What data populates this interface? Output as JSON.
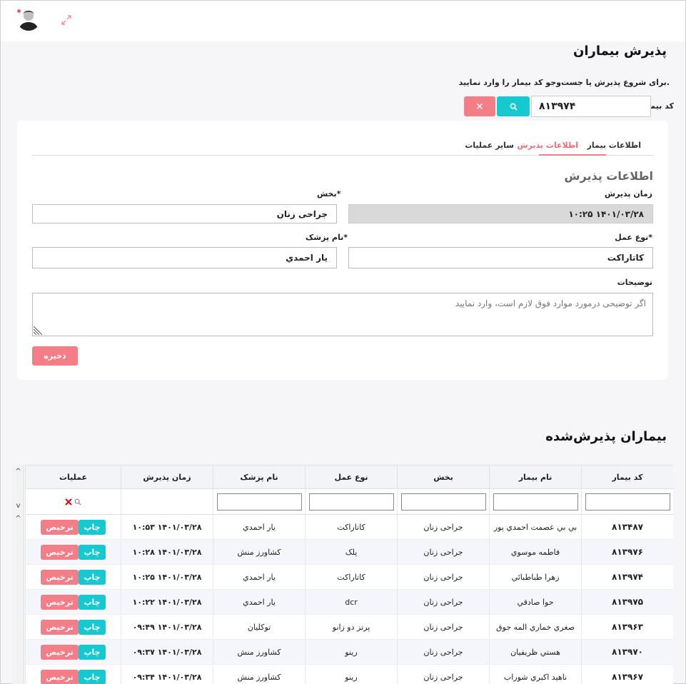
{
  "header": {
    "avatar": "user-avatar",
    "expand_icon": "expand-icon"
  },
  "page": {
    "title": "پذیرش بیماران",
    "hint": "برای شروع پذیرش یا جست‌وجو کد بیمار را وارد نمایید.",
    "code_label": "کد بیمار",
    "code_value": "۸۱۳۹۷۴",
    "clear_label": "×"
  },
  "tabs": [
    {
      "label": "اطلاعات بیمار"
    },
    {
      "label": "اطلاعات پذیرش"
    },
    {
      "label": "سایر عملیات"
    }
  ],
  "form": {
    "section_title": "اطلاعات پذیرش",
    "time_label": "زمان پذیرش",
    "time_value": "۱۴۰۱/۰۳/۲۸ ۱۰:۲۵",
    "dept_label": "بخش*",
    "dept_value": "جراحی زنان",
    "op_label": "نوع عمل*",
    "op_value": "کاتاراکت",
    "doctor_label": "نام پزشک*",
    "doctor_value": "یار احمدي",
    "notes_label": "توضیحات",
    "notes_placeholder": "اگر توضیحی درمورد موارد فوق لازم است، وارد نمایید",
    "save_label": "ذخیره"
  },
  "admitted": {
    "title": "بیماران پذیرش‌شده",
    "columns": [
      "کد بیمار",
      "نام بیمار",
      "بخش",
      "نوع عمل",
      "نام پزشک",
      "زمان پذیرش",
      "عملیات"
    ],
    "print_label": "چاپ",
    "discharge_label": "ترخیص",
    "rows": [
      {
        "code": "۸۱۳۴۸۷",
        "name": "بي بي عصمت احمدي پور",
        "dept": "جراحی زنان",
        "op": "کاتاراکت",
        "doctor": "یار احمدي",
        "time": "۱۴۰۱/۰۳/۲۸ ۱۰:۵۳"
      },
      {
        "code": "۸۱۳۹۷۶",
        "name": "فاطمه موسوي",
        "dept": "جراحی زنان",
        "op": "پلک",
        "doctor": "کشاورز منش",
        "time": "۱۴۰۱/۰۳/۲۸ ۱۰:۲۸"
      },
      {
        "code": "۸۱۳۹۷۴",
        "name": "زهرا طباطبائي",
        "dept": "جراحی زنان",
        "op": "کاتاراکت",
        "doctor": "یار احمدي",
        "time": "۱۴۰۱/۰۳/۲۸ ۱۰:۲۵"
      },
      {
        "code": "۸۱۳۹۷۵",
        "name": "حوا صادقي",
        "dept": "جراحی زنان",
        "op": "dcr",
        "doctor": "یار احمدي",
        "time": "۱۴۰۱/۰۳/۲۸ ۱۰:۲۲"
      },
      {
        "code": "۸۱۳۹۶۳",
        "name": "صغري خماري المه جوق",
        "dept": "جراحی زنان",
        "op": "پرتز دو زانو",
        "doctor": "توکلیان",
        "time": "۱۴۰۱/۰۳/۲۸ ۰۹:۴۹"
      },
      {
        "code": "۸۱۳۹۷۰",
        "name": "هستي ظريفيان",
        "dept": "جراحی زنان",
        "op": "رینو",
        "doctor": "کشاورز منش",
        "time": "۱۴۰۱/۰۳/۲۸ ۰۹:۳۷"
      },
      {
        "code": "۸۱۳۹۶۷",
        "name": "ناهيد اكبري شوراب",
        "dept": "جراحی زنان",
        "op": "رینو",
        "doctor": "کشاورز منش",
        "time": "۱۴۰۱/۰۳/۲۸ ۰۹:۳۴"
      }
    ]
  }
}
